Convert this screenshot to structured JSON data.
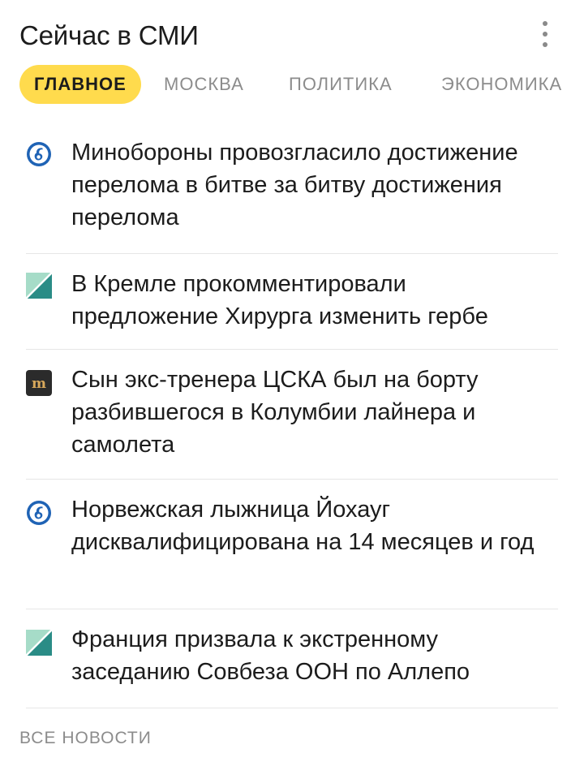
{
  "header": {
    "title": "Сейчас в СМИ",
    "menu_icon": "more-vertical-icon"
  },
  "tabs": [
    {
      "label": "ГЛАВНОЕ",
      "active": true
    },
    {
      "label": "МОСКВА",
      "active": false
    },
    {
      "label": "ПОЛИТИКА",
      "active": false
    },
    {
      "label": "ЭКОНОМИКА",
      "active": false
    }
  ],
  "colors": {
    "active_tab_bg": "#ffdb4d",
    "text": "#1c1c1c",
    "muted": "#8c8c8c",
    "divider": "#e6e6e6"
  },
  "news": [
    {
      "icon": "round-blue-logo-icon",
      "text": "Минобороны провозгласило достижение перелома в битве за битву достижения перелома"
    },
    {
      "icon": "green-teal-square-logo-icon",
      "text": "В Кремле прокомментировали предложение Хирурга изменить гербе"
    },
    {
      "icon": "dark-m-logo-icon",
      "text": "Сын экс-тренера ЦСКА был на борту разбившегося в Колумбии лайнера и самолета"
    },
    {
      "icon": "round-blue-logo-icon",
      "text": "Норвежская лыжница Йохауг дисквалифицирована на 14 месяцев и год"
    },
    {
      "icon": "green-teal-square-logo-icon",
      "text": "Франция призвала к экстренному заседанию Совбеза ООН по Аллепо"
    }
  ],
  "footer": {
    "all_news_label": "ВСЕ НОВОСТИ"
  }
}
